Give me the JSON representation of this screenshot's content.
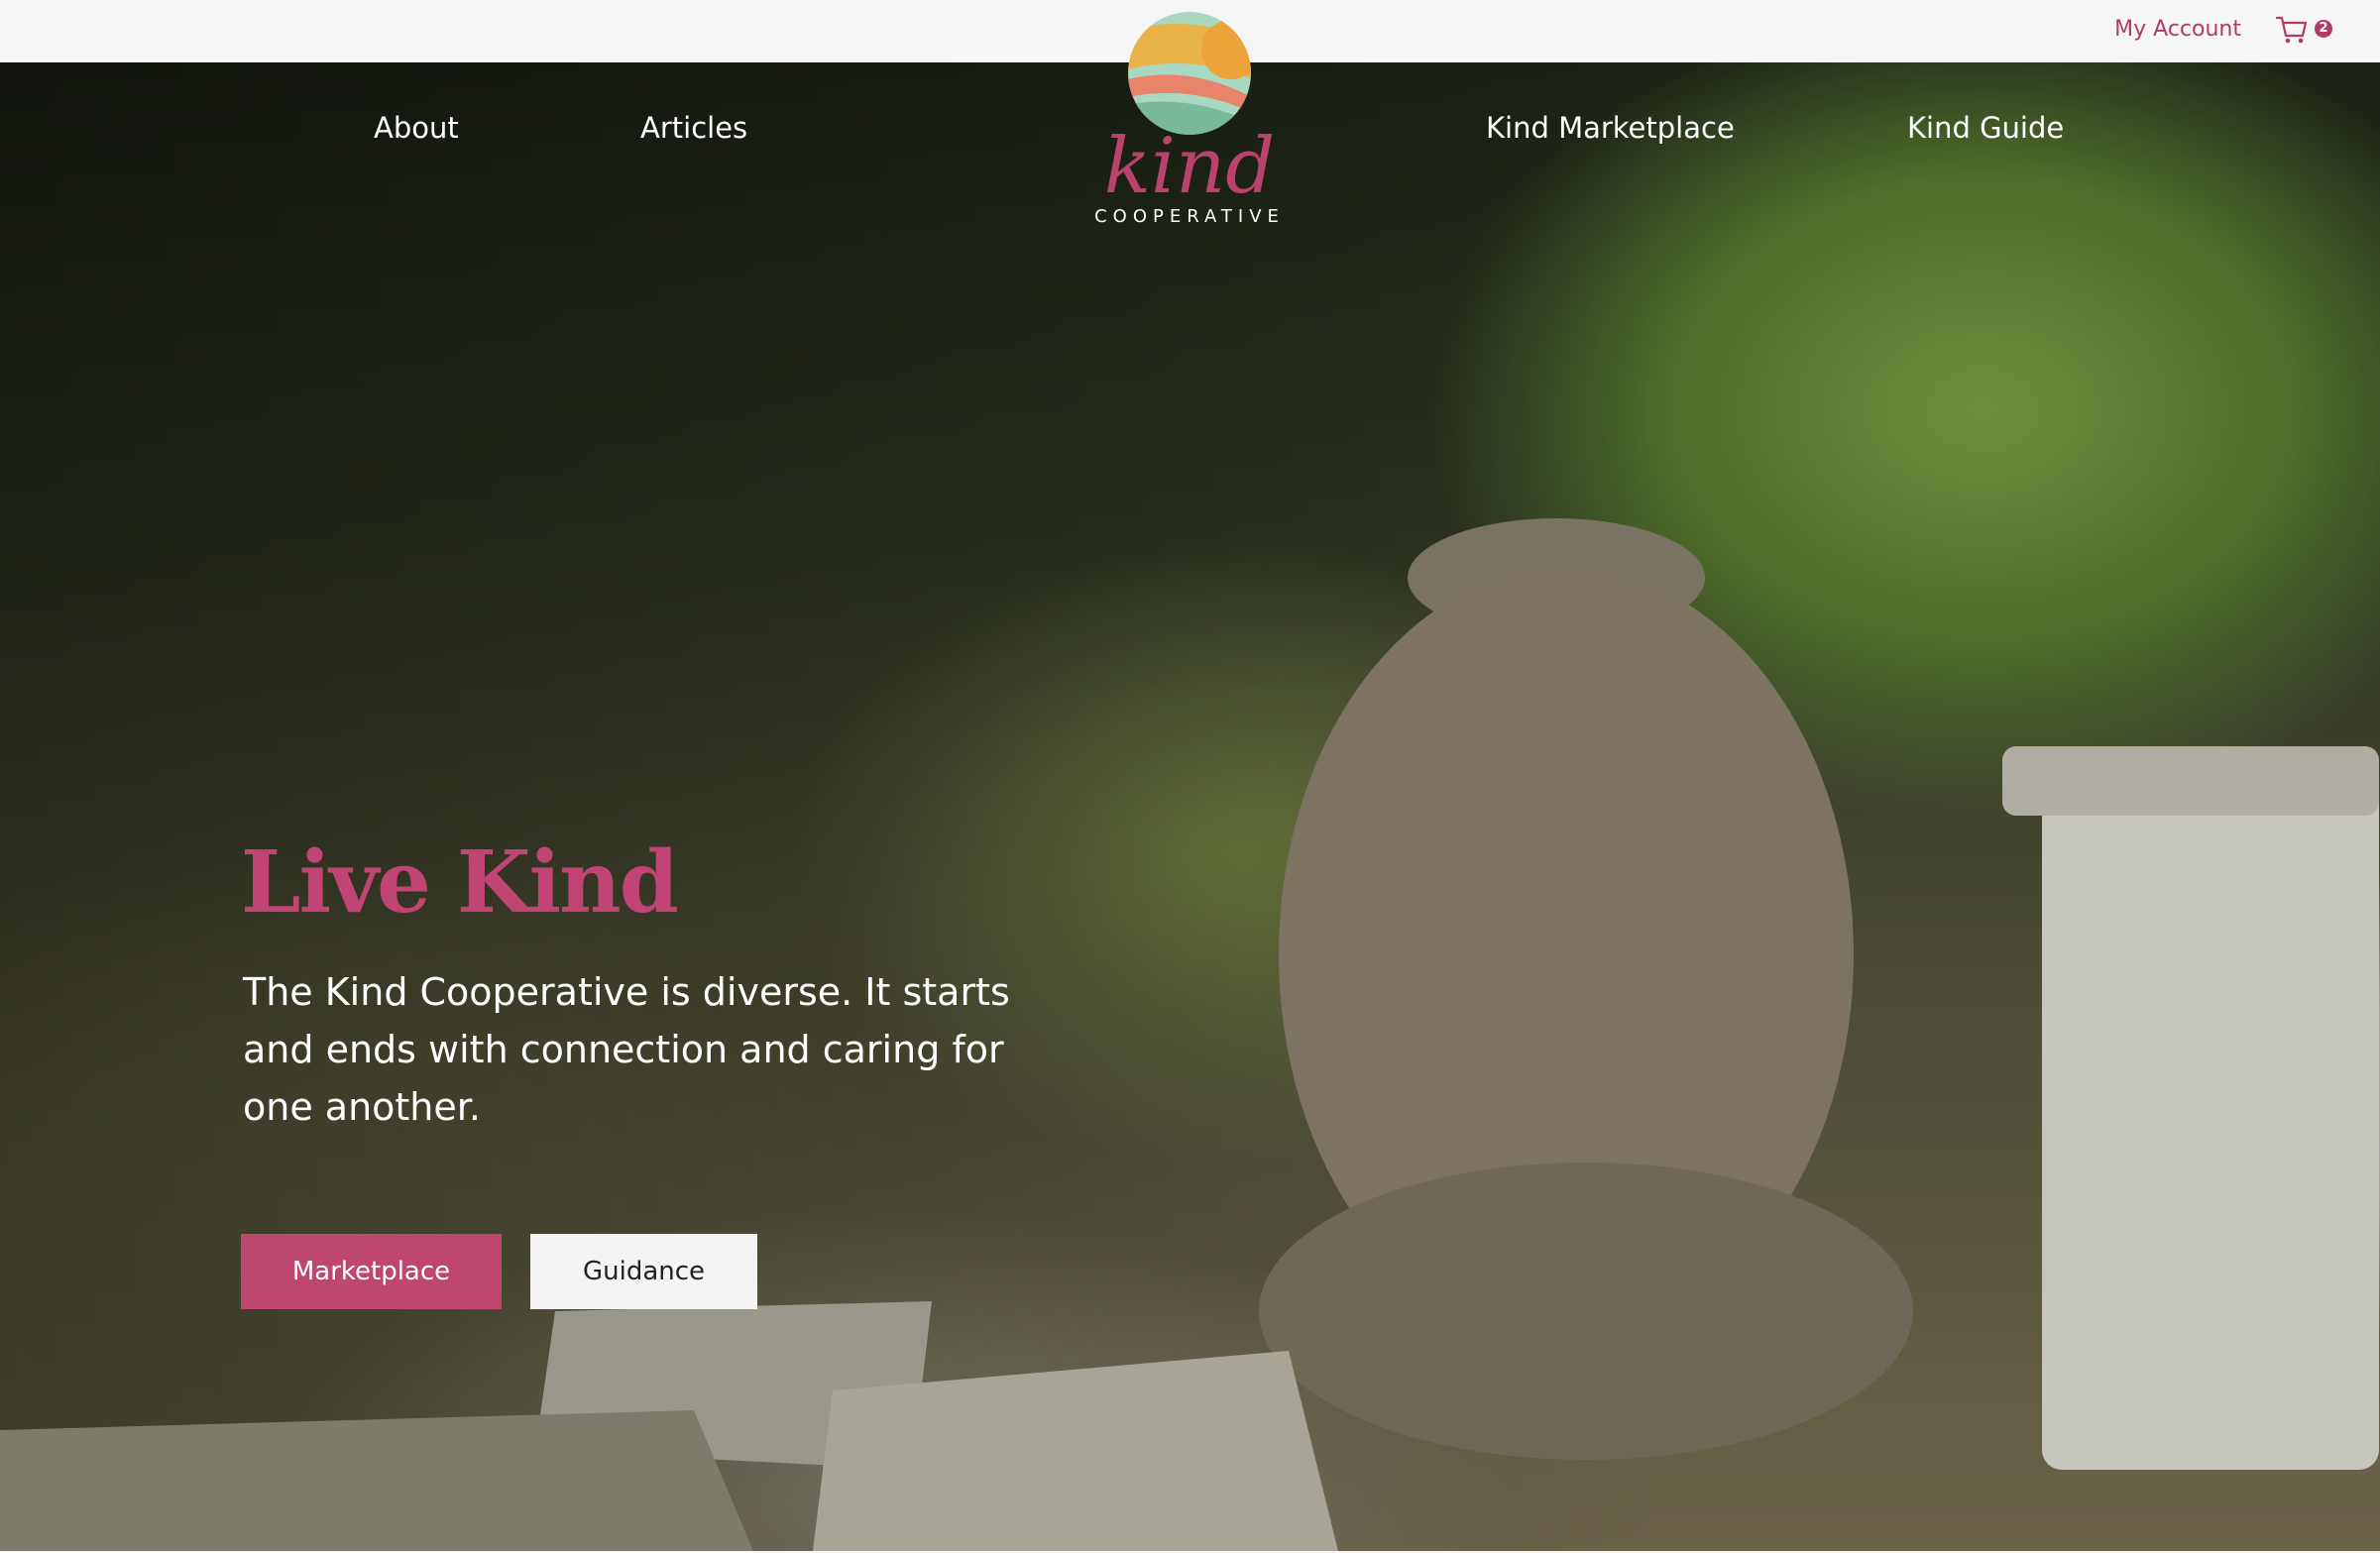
{
  "header": {
    "account_label": "My Account",
    "cart_count": "2",
    "cart_icon": "shopping-cart-icon"
  },
  "nav": {
    "items": [
      {
        "label": "About"
      },
      {
        "label": "Articles"
      },
      {
        "label": "Kind Marketplace"
      },
      {
        "label": "Kind Guide"
      }
    ]
  },
  "logo": {
    "wordmark": "kind",
    "subtitle": "COOPERATIVE"
  },
  "hero": {
    "headline": "Live Kind",
    "subtext": "The Kind Cooperative is diverse. It starts and ends with connection and caring for one another.",
    "primary_button": "Marketplace",
    "secondary_button": "Guidance"
  },
  "colors": {
    "brand_pink": "#bf466f",
    "topbar_bg": "#f6f6f6",
    "secondary_button_bg": "#f4f4f4"
  }
}
